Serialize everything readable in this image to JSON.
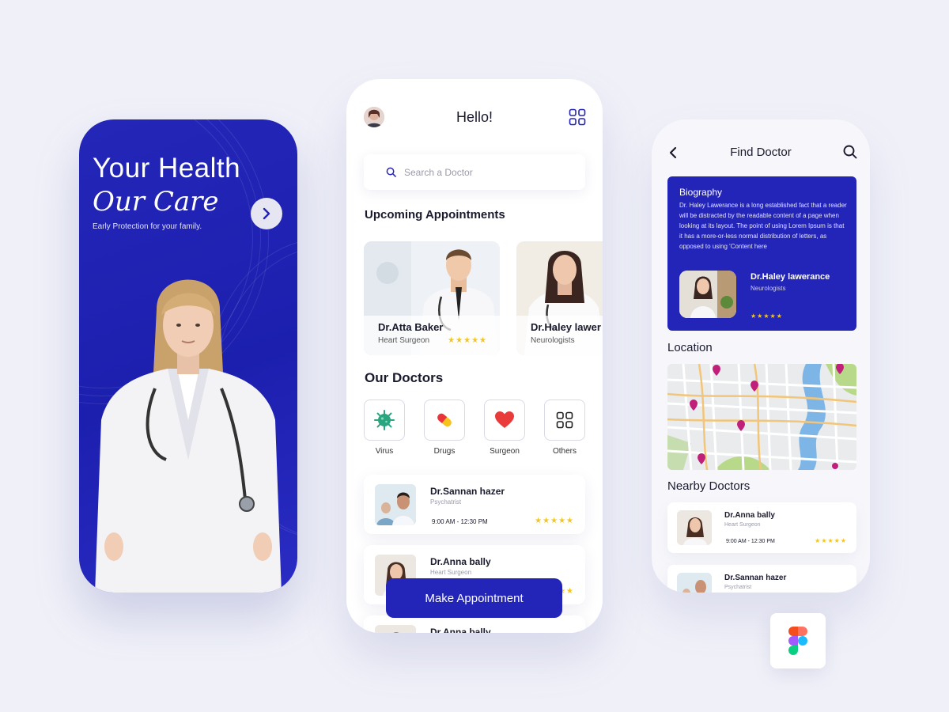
{
  "colors": {
    "brand": "#2324b8",
    "star": "#f5c518",
    "background": "#f0f1f8"
  },
  "splash": {
    "title_line1": "Your Health",
    "title_line2": "Our Care",
    "subtitle": "Early Protection for your family.",
    "next_icon": "chevron-right-icon"
  },
  "home": {
    "greeting": "Hello!",
    "avatar_icon": "avatar",
    "menu_icon": "grid-icon",
    "search_placeholder": "Search a Doctor",
    "upcoming_heading": "Upcoming Appointments",
    "appointments": [
      {
        "name": "Dr.Atta Baker",
        "specialty": "Heart Surgeon",
        "rating": "★★★★★"
      },
      {
        "name": "Dr.Haley lawer",
        "specialty": "Neurologists"
      }
    ],
    "our_doctors_heading": "Our Doctors",
    "categories": [
      {
        "label": "Virus",
        "icon": "virus-icon"
      },
      {
        "label": "Drugs",
        "icon": "pill-icon"
      },
      {
        "label": "Surgeon",
        "icon": "heart-icon"
      },
      {
        "label": "Others",
        "icon": "grid-icon"
      }
    ],
    "doctors": [
      {
        "name": "Dr.Sannan hazer",
        "specialty": "Psychatrist",
        "time": "9:00 AM - 12:30 PM",
        "rating": "★★★★★"
      },
      {
        "name": "Dr.Anna bally",
        "specialty": "Heart Surgeon",
        "time": "",
        "rating": "★★"
      },
      {
        "name": "Dr.Anna bally"
      }
    ],
    "make_appointment": "Make Appointment"
  },
  "find": {
    "title": "Find Doctor",
    "back_icon": "chevron-left-icon",
    "search_icon": "search-icon",
    "bio_heading": "Biography",
    "bio_text": "Dr. Haley Lawerance  is a long established fact that a reader will be distracted by the readable content of a page when looking at its layout. The point of using Lorem Ipsum is that it has a more-or-less normal distribution of letters, as opposed to using 'Content here",
    "bio_doctor_name": "Dr.Haley lawerance",
    "bio_doctor_specialty": "Neurologists",
    "bio_rating": "★★★★★",
    "location_heading": "Location",
    "nearby_heading": "Nearby Doctors",
    "nearby": [
      {
        "name": "Dr.Anna bally",
        "specialty": "Heart Surgeon",
        "time": "9:00 AM - 12:30 PM",
        "rating": "★★★★★"
      },
      {
        "name": "Dr.Sannan hazer",
        "specialty": "Psychatrist"
      }
    ]
  }
}
